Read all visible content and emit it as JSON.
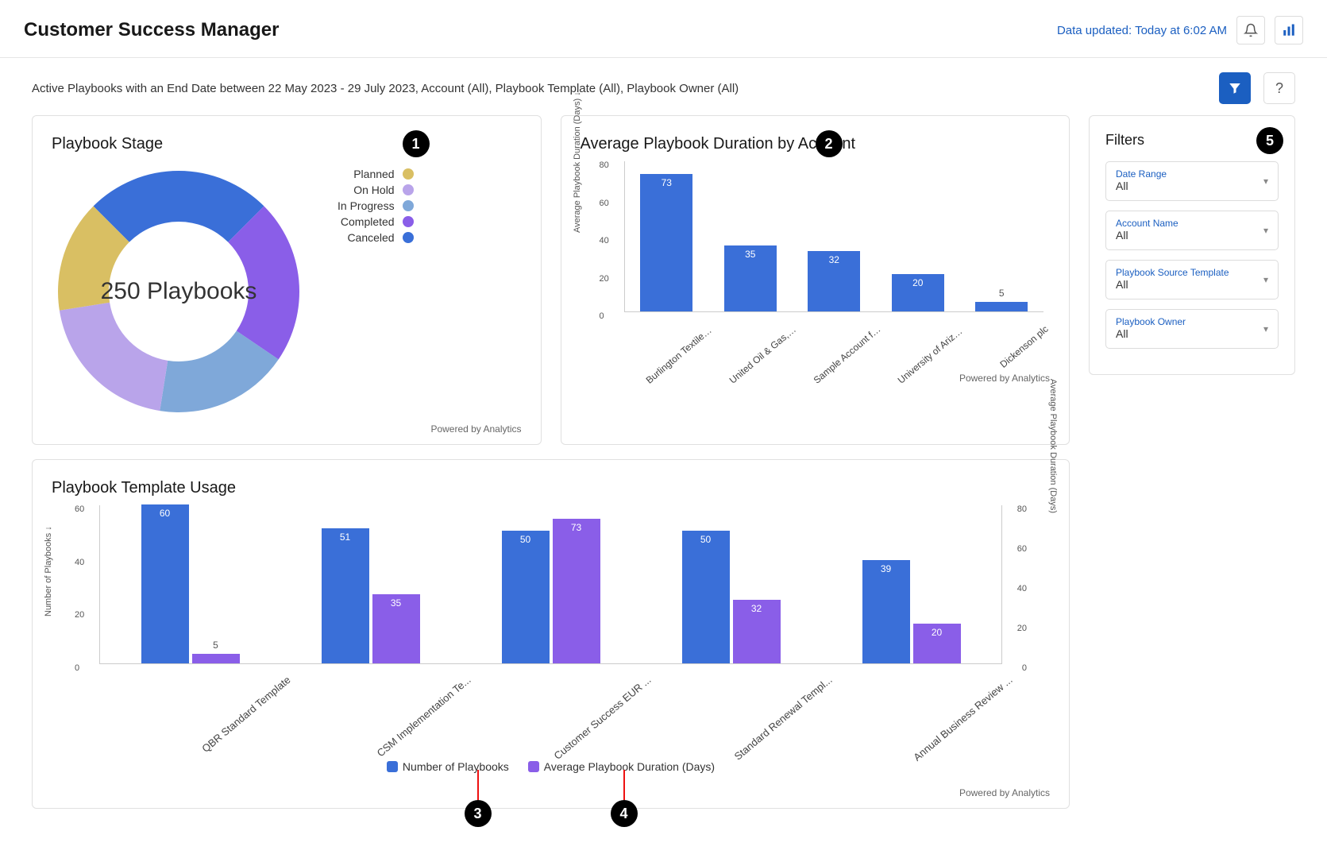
{
  "header": {
    "title": "Customer Success Manager",
    "update_text": "Data updated: Today at 6:02 AM"
  },
  "filter_summary": "Active Playbooks with an End Date between 22 May 2023 - 29 July 2023, Account (All), Playbook Template (All), Playbook Owner (All)",
  "help_label": "?",
  "callouts": {
    "one": "1",
    "two": "2",
    "three": "3",
    "four": "4",
    "five": "5"
  },
  "powered": "Powered by Analytics",
  "donut": {
    "title": "Playbook Stage",
    "center_text": "250 Playbooks",
    "legend": [
      {
        "label": "Planned",
        "color": "#d9bf63"
      },
      {
        "label": "On Hold",
        "color": "#b9a4ea"
      },
      {
        "label": "In Progress",
        "color": "#7fa8d9"
      },
      {
        "label": "Completed",
        "color": "#8a5ee8"
      },
      {
        "label": "Canceled",
        "color": "#3a6fd8"
      }
    ]
  },
  "bar": {
    "title": "Average Playbook Duration by Account",
    "ylabel": "Average Playbook Duration (Days) ↓",
    "ticks": [
      "0",
      "20",
      "40",
      "60",
      "80"
    ]
  },
  "usage": {
    "title": "Playbook Template Usage",
    "ylabel_left": "Number of Playbooks ↓",
    "ylabel_right": "Average Playbook Duration (Days)",
    "legend_a": "Number of Playbooks",
    "legend_b": "Average Playbook Duration (Days)",
    "ticks_left": [
      "0",
      "20",
      "40",
      "60"
    ],
    "ticks_right": [
      "0",
      "20",
      "40",
      "60",
      "80"
    ]
  },
  "filters": {
    "title": "Filters",
    "fields": [
      {
        "label": "Date Range",
        "value": "All"
      },
      {
        "label": "Account Name",
        "value": "All"
      },
      {
        "label": "Playbook Source Template",
        "value": "All"
      },
      {
        "label": "Playbook Owner",
        "value": "All"
      }
    ]
  },
  "colors": {
    "blue": "#3a6fd8",
    "purple": "#8a5ee8"
  },
  "chart_data": [
    {
      "id": "playbook_stage",
      "type": "pie",
      "title": "Playbook Stage",
      "total_label": "250 Playbooks",
      "series": [
        {
          "name": "Planned",
          "percent": 15,
          "color": "#d9bf63"
        },
        {
          "name": "On Hold",
          "percent": 20,
          "color": "#b9a4ea"
        },
        {
          "name": "In Progress",
          "percent": 18,
          "color": "#7fa8d9"
        },
        {
          "name": "Completed",
          "percent": 22,
          "color": "#8a5ee8"
        },
        {
          "name": "Canceled",
          "percent": 25,
          "color": "#3a6fd8"
        }
      ]
    },
    {
      "id": "avg_duration_by_account",
      "type": "bar",
      "title": "Average Playbook Duration by Account",
      "ylabel": "Average Playbook Duration (Days)",
      "ylim": [
        0,
        80
      ],
      "categories": [
        "Burlington Textiles Co...",
        "United Oil & Gas, UK",
        "Sample Account for Entitle...",
        "University of Arizona",
        "Dickenson plc"
      ],
      "values": [
        73,
        35,
        32,
        20,
        5
      ]
    },
    {
      "id": "template_usage",
      "type": "bar",
      "title": "Playbook Template Usage",
      "categories": [
        "QBR Standard Template",
        "CSM Implementation Te...",
        "Customer Success EUR ...",
        "Standard Renewal Templ...",
        "Annual Business Review ..."
      ],
      "series": [
        {
          "name": "Number of Playbooks",
          "axis": "left",
          "color": "#3a6fd8",
          "ylim": [
            0,
            60
          ],
          "values": [
            60,
            51,
            50,
            50,
            39
          ]
        },
        {
          "name": "Average Playbook Duration (Days)",
          "axis": "right",
          "color": "#8a5ee8",
          "ylim": [
            0,
            80
          ],
          "values": [
            5,
            35,
            73,
            32,
            20
          ]
        }
      ]
    }
  ]
}
